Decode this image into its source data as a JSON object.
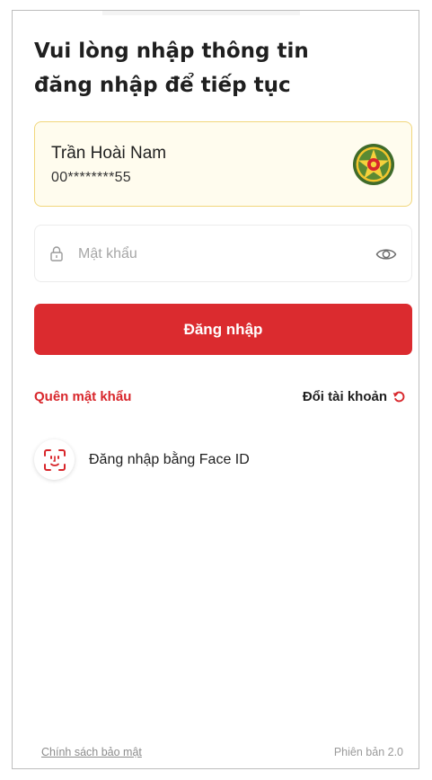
{
  "header": {
    "title_line1": "Vui lòng nhập thông tin",
    "title_line2": "đăng nhập để tiếp tục"
  },
  "account": {
    "name": "Trần Hoài Nam",
    "number_masked": "00********55",
    "emblem_icon": "army-emblem-icon"
  },
  "password": {
    "placeholder": "Mật khẩu",
    "value": "",
    "lock_icon": "lock-icon",
    "toggle_icon": "eye-icon"
  },
  "login_button": {
    "label": "Đăng nhập"
  },
  "links": {
    "forgot_password": "Quên mật khẩu",
    "switch_account": "Đổi tài khoản",
    "switch_icon": "refresh-icon"
  },
  "face_id": {
    "label": "Đăng nhập bằng Face ID",
    "icon": "face-id-icon"
  },
  "footer": {
    "privacy_policy": "Chính sách bảo mật",
    "version": "Phiên bản 2.0"
  },
  "colors": {
    "primary_red": "#db2b2f",
    "card_background": "#fffcee",
    "card_border": "#f1d77c"
  }
}
